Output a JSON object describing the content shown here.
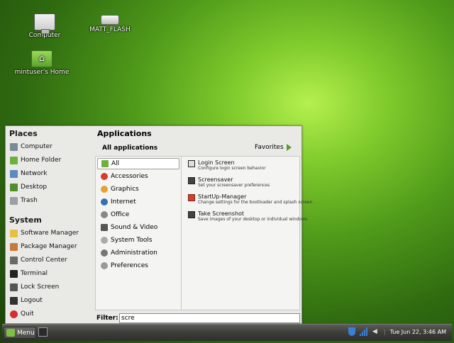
{
  "desktop": {
    "icons": [
      {
        "label": "Computer",
        "icon": "computer-icon"
      },
      {
        "label": "MATT_FLASH",
        "icon": "usb-drive-icon"
      },
      {
        "label": "mintuser's Home",
        "icon": "home-folder-icon"
      }
    ]
  },
  "menu": {
    "places_title": "Places",
    "places": [
      "Computer",
      "Home Folder",
      "Network",
      "Desktop",
      "Trash"
    ],
    "system_title": "System",
    "system": [
      "Software Manager",
      "Package Manager",
      "Control Center",
      "Terminal",
      "Lock Screen",
      "Logout",
      "Quit"
    ],
    "applications_title": "Applications",
    "all_applications": "All applications",
    "favorites": "Favorites",
    "categories": [
      "All",
      "Accessories",
      "Graphics",
      "Internet",
      "Office",
      "Sound & Video",
      "System Tools",
      "Administration",
      "Preferences"
    ],
    "selected_category": "All",
    "results": [
      {
        "name": "Login Screen",
        "desc": "Configure login screen behavior"
      },
      {
        "name": "Screensaver",
        "desc": "Set your screensaver preferences"
      },
      {
        "name": "StartUp-Manager",
        "desc": "Change settings for the bootloader and splash screen"
      },
      {
        "name": "Take Screenshot",
        "desc": "Save images of your desktop or individual windows"
      }
    ],
    "filter_label": "Filter:",
    "filter_value": "scre"
  },
  "panel": {
    "menu_label": "Menu",
    "clock": "Tue Jun 22,  3:46 AM"
  },
  "colors": {
    "accent": "#7cc242",
    "panel": "#3c3c39"
  }
}
